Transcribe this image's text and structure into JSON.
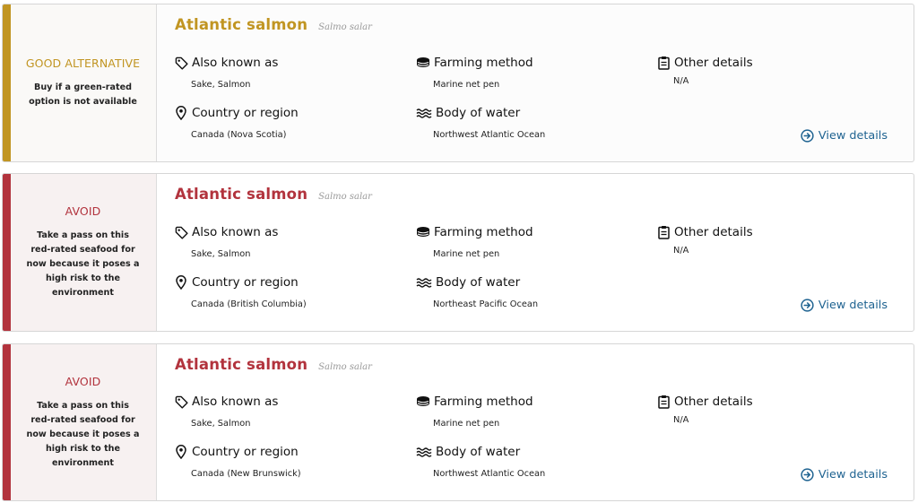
{
  "colors": {
    "good": "#c19522",
    "avoid": "#b2333d",
    "link": "#1f6391"
  },
  "labels": {
    "also_known_as": "Also known as",
    "farming_method": "Farming method",
    "other_details": "Other details",
    "country_or_region": "Country or region",
    "body_of_water": "Body of water",
    "view_details": "View details"
  },
  "icons": {
    "also_known_as": "tag-icon",
    "farming_method": "net-pen-icon",
    "other_details": "clipboard-icon",
    "country_or_region": "map-pin-icon",
    "body_of_water": "waves-icon",
    "view_details": "arrow-circle-right-icon"
  },
  "cards": [
    {
      "rating": "good",
      "rating_title": "GOOD ALTERNATIVE",
      "rating_desc": "Buy if a green-rated option is not available",
      "name": "Atlantic salmon",
      "scientific_name": "Salmo salar",
      "also_known_as": "Sake, Salmon",
      "farming_method": "Marine net pen",
      "other_details": "N/A",
      "country_or_region": "Canada (Nova Scotia)",
      "body_of_water": "Northwest Atlantic Ocean"
    },
    {
      "rating": "avoid",
      "rating_title": "AVOID",
      "rating_desc": "Take a pass on this red-rated seafood for now because it poses a high risk to the environment",
      "name": "Atlantic salmon",
      "scientific_name": "Salmo salar",
      "also_known_as": "Sake, Salmon",
      "farming_method": "Marine net pen",
      "other_details": "N/A",
      "country_or_region": "Canada (British Columbia)",
      "body_of_water": "Northeast Pacific Ocean"
    },
    {
      "rating": "avoid",
      "rating_title": "AVOID",
      "rating_desc": "Take a pass on this red-rated seafood for now because it poses a high risk to the environment",
      "name": "Atlantic salmon",
      "scientific_name": "Salmo salar",
      "also_known_as": "Sake, Salmon",
      "farming_method": "Marine net pen",
      "other_details": "N/A",
      "country_or_region": "Canada (New Brunswick)",
      "body_of_water": "Northwest Atlantic Ocean"
    }
  ]
}
